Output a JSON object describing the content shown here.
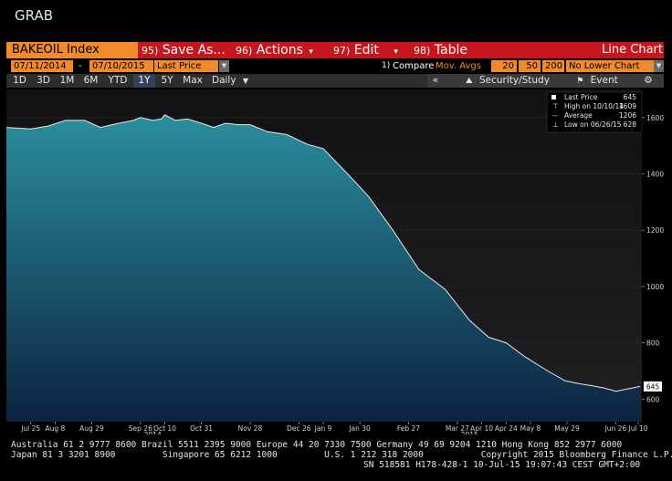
{
  "window_title": "GRAB",
  "toolbar": {
    "ticker": "BAKEOIL Index",
    "buttons": [
      {
        "num": "95)",
        "label": "Save As..."
      },
      {
        "num": "96)",
        "label": "Actions"
      },
      {
        "num": "97)",
        "label": "Edit"
      },
      {
        "num": "98)",
        "label": "Table"
      }
    ],
    "chart_type": "Line Chart"
  },
  "range": {
    "start": "07/11/2014",
    "dash": "-",
    "end": "07/10/2015",
    "field": "Last Price",
    "compare_num": "1)",
    "compare_label": "Compare",
    "mov_avgs": "Mov. Avgs",
    "ma1": "20",
    "ma2": "50",
    "ma3": "200",
    "lower_chart": "No Lower Chart"
  },
  "periods": [
    "1D",
    "3D",
    "1M",
    "6M",
    "YTD",
    "1Y",
    "5Y",
    "Max"
  ],
  "active_period": "1Y",
  "frequency": "Daily",
  "study_bar": {
    "collapse": "«",
    "security_study": "Security/Study",
    "event": "Event"
  },
  "legend": {
    "last_price_label": "Last Price",
    "last_price_value": "645",
    "high_label": "High on 10/10/14",
    "high_value": "1609",
    "average_label": "Average",
    "average_value": "1206",
    "low_label": "Low on 06/26/15",
    "low_value": "628"
  },
  "chart_data": {
    "type": "area",
    "series": [
      {
        "name": "Last Price",
        "values": [
          1565,
          1560,
          1570,
          1590,
          1590,
          1565,
          1578,
          1590,
          1600,
          1590,
          1595,
          1610,
          1590,
          1595,
          1580,
          1565,
          1580,
          1575,
          1575,
          1550,
          1540,
          1505,
          1490,
          1400,
          1320,
          1200,
          1060,
          990,
          880,
          820,
          800,
          750,
          700,
          665,
          655,
          648,
          640,
          632,
          628,
          645
        ]
      }
    ],
    "x": [
      "2014-07-14",
      "2014-07-25",
      "2014-08-04",
      "2014-08-14",
      "2014-08-25",
      "2014-09-03",
      "2014-09-12",
      "2014-09-22",
      "2014-09-26",
      "2014-10-03",
      "2014-10-08",
      "2014-10-10",
      "2014-10-16",
      "2014-10-23",
      "2014-10-31",
      "2014-11-07",
      "2014-11-14",
      "2014-11-21",
      "2014-11-28",
      "2014-12-08",
      "2014-12-19",
      "2014-12-31",
      "2015-01-09",
      "2015-01-23",
      "2015-02-04",
      "2015-02-18",
      "2015-03-05",
      "2015-03-20",
      "2015-04-03",
      "2015-04-14",
      "2015-04-24",
      "2015-05-05",
      "2015-05-18",
      "2015-05-28",
      "2015-06-05",
      "2015-06-12",
      "2015-06-19",
      "2015-06-24",
      "2015-06-26",
      "2015-07-10"
    ],
    "ylim": [
      520,
      1700
    ],
    "yticks": [
      "1600",
      "1400",
      "1200",
      "1000",
      "800",
      "600"
    ],
    "ytick_values": [
      1600,
      1400,
      1200,
      1000,
      800,
      600
    ],
    "last_value_label": "645",
    "xticks": [
      {
        "date": "2014-07-25",
        "label": "Jul 25"
      },
      {
        "date": "2014-08-08",
        "label": "Aug 8"
      },
      {
        "date": "2014-08-29",
        "label": "Aug 29"
      },
      {
        "date": "2014-09-26",
        "label": "Sep 26"
      },
      {
        "date": "2014-10-10",
        "label": "Oct 10"
      },
      {
        "date": "2014-10-31",
        "label": "Oct 31"
      },
      {
        "date": "2014-11-28",
        "label": "Nov 28"
      },
      {
        "date": "2014-12-26",
        "label": "Dec 26"
      },
      {
        "date": "2015-01-09",
        "label": "Jan 9"
      },
      {
        "date": "2015-01-30",
        "label": "Jan 30"
      },
      {
        "date": "2015-02-27",
        "label": "Feb 27"
      },
      {
        "date": "2015-03-27",
        "label": "Mar 27"
      },
      {
        "date": "2015-04-10",
        "label": "Apr 10"
      },
      {
        "date": "2015-04-24",
        "label": "Apr 24"
      },
      {
        "date": "2015-05-08",
        "label": "May 8"
      },
      {
        "date": "2015-05-29",
        "label": "May 29"
      },
      {
        "date": "2015-06-26",
        "label": "Jun 26"
      },
      {
        "date": "2015-07-10",
        "label": "Jul 10"
      }
    ],
    "year_labels": [
      {
        "date": "2014-10-03",
        "label": "2014"
      },
      {
        "date": "2015-04-03",
        "label": "2015"
      }
    ],
    "grid": true,
    "legend_position": "top-right",
    "fill_color_top": "#2a8f9e",
    "fill_color_bottom": "#0c2340",
    "line_color": "#e8e8e8"
  },
  "footer": {
    "line1": "Australia 61 2 9777 8600 Brazil 5511 2395 9000 Europe 44 20 7330 7500 Germany 49 69 9204 1210 Hong Kong 852 2977 6000",
    "line2": "Japan 81 3 3201 8900         Singapore 65 6212 1000         U.S. 1 212 318 2000           Copyright 2015 Bloomberg Finance L.P.",
    "line3": "SN 518581 H178-428-1 10-Jul-15 19:07:43 CEST GMT+2:00"
  },
  "colors": {
    "accent_red": "#c5151d",
    "accent_orange": "#f08a2a",
    "period_bar": "#2e2e2e"
  }
}
